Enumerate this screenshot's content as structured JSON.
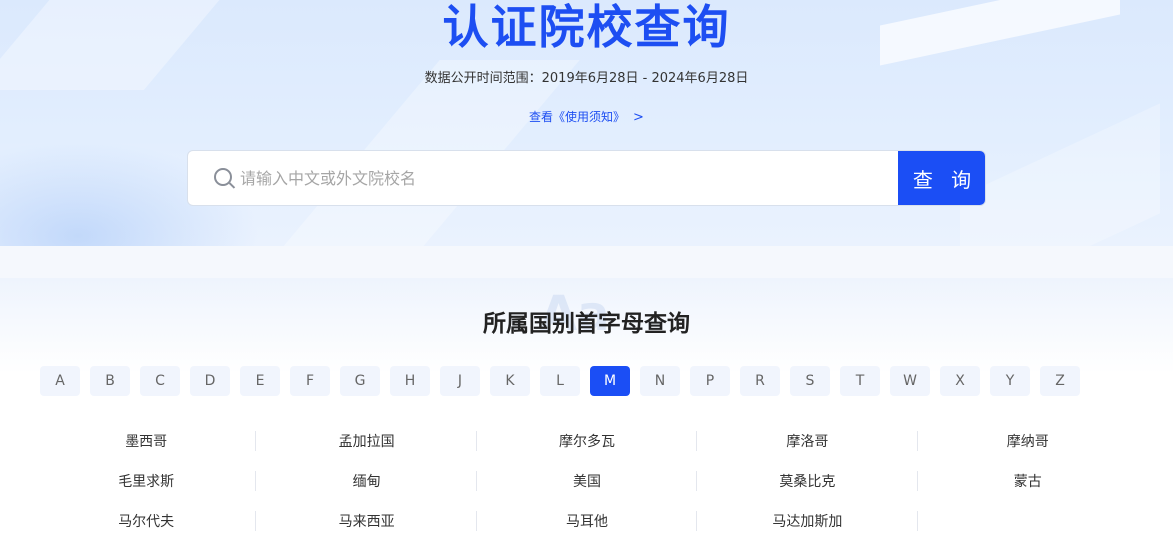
{
  "header": {
    "title": "认证院校查询",
    "date_range": "数据公开时间范围：2019年6月28日 - 2024年6月28日",
    "notice_link": "查看《使用须知》",
    "notice_chevron": ">"
  },
  "search": {
    "placeholder": "请输入中文或外文院校名",
    "value": "",
    "button_label": "查 询",
    "icon": "search-icon"
  },
  "letter_section": {
    "title": "所属国别首字母查询",
    "letters": [
      "A",
      "B",
      "C",
      "D",
      "E",
      "F",
      "G",
      "H",
      "J",
      "K",
      "L",
      "M",
      "N",
      "P",
      "R",
      "S",
      "T",
      "W",
      "X",
      "Y",
      "Z"
    ],
    "active_letter": "M"
  },
  "countries": [
    "墨西哥",
    "孟加拉国",
    "摩尔多瓦",
    "摩洛哥",
    "摩纳哥",
    "毛里求斯",
    "缅甸",
    "美国",
    "莫桑比克",
    "蒙古",
    "马尔代夫",
    "马来西亚",
    "马耳他",
    "马达加斯加"
  ],
  "colors": {
    "accent": "#1b4ef5",
    "title": "#1d4ef2"
  }
}
